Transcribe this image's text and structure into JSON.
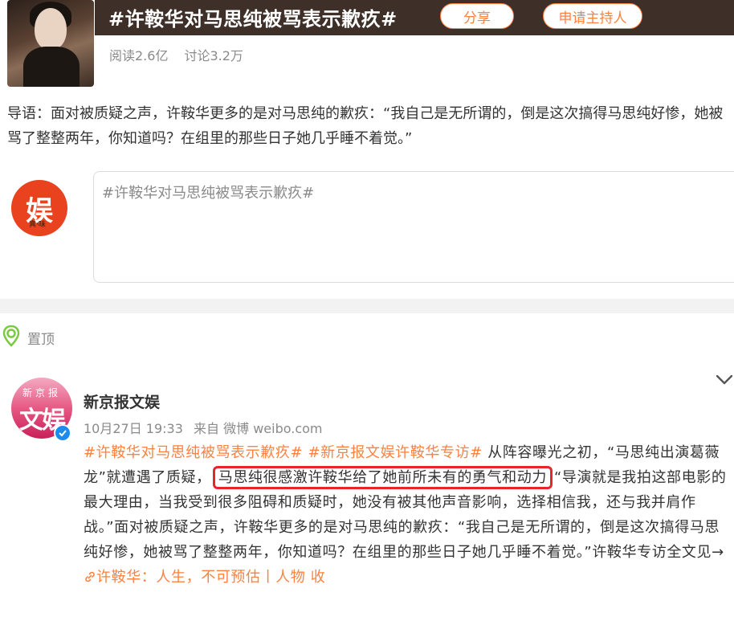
{
  "header": {
    "topic_title": "#许鞍华对马思纯被骂表示歉疚#",
    "share_label": "分享",
    "apply_host_label": "申请主持人",
    "reads": "阅读2.6亿",
    "discussions": "讨论3.2万"
  },
  "intro": {
    "text": "导语：面对被质疑之声，许鞍华更多的是对马思纯的歉疚：“我自己是无所谓的，倒是这次搞得马思纯好惨，她被骂了整整两年，你知道吗？在组里的那些日子她几乎睡不着觉。”"
  },
  "composer": {
    "avatar_char": "娱",
    "avatar_signature": "真·味",
    "prefilled_text": "#许鞍华对马思纯被骂表示歉疚#"
  },
  "pinned": {
    "label": "置顶"
  },
  "post": {
    "avatar_top": "新京报",
    "avatar_main": "文娱",
    "author": "新京报文娱",
    "date": "10月27日 19:33",
    "source": "来自 微博 weibo.com",
    "tag1": "#许鞍华对马思纯被骂表示歉疚#",
    "tag2": "#新京报文娱许鞍华专访#",
    "text1": "从阵容曝光之初，“马思纯出演葛薇龙”就遭遇了质疑，",
    "highlight": "马思纯很感激许鞍华给了她前所未有的勇气和动力",
    "text2": "“导演就是我拍这部电影的最大理由，当我受到很多阻碍和质疑时，她没有被其他声音影响，选择相信我，还与我并肩作战。”面对被质疑之声，许鞍华更多的是对马思纯的歉疚：“我自己是无所谓的，倒是这次搞得马思纯好惨，她被骂了整整两年，你知道吗？在组里的那些日子她几乎睡不着觉。”许鞍华专访全文见→",
    "link_text": "许鞍华：人生，不可预估丨人物 收"
  },
  "colors": {
    "accent": "#ff8140",
    "header_bg": "#3e3029",
    "highlight_border": "#e8262a",
    "verified": "#1b8bf0"
  }
}
